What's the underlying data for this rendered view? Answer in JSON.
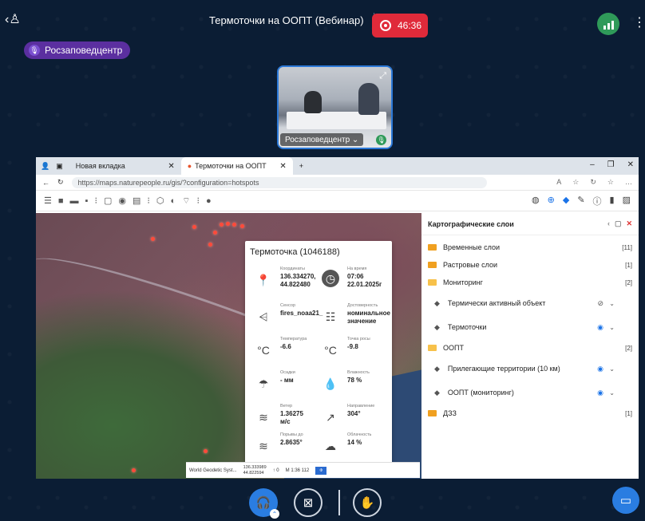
{
  "topbar": {
    "back_icon": "‹♙",
    "title": "Термоточки на ООПТ (Вебинар)",
    "recording_time": "46:36",
    "more_icon": "⋮"
  },
  "organizer_chip": "Росзаповедцентр",
  "video_tile": {
    "name": "Росзаповедцентр ⌄"
  },
  "browser": {
    "tab_new": "Новая вкладка",
    "tab_active": "Термоточки на ООПТ",
    "url": "https://maps.naturepeople.ru/gis/?configuration=hotspots"
  },
  "popup": {
    "title": "Термоточка (1046188)",
    "coords_label": "Координаты",
    "coords_value": "136.334270,\n44.822480",
    "time_label": "На время",
    "time_value": "07:06\n22.01.2025г",
    "sensor_label": "Сенсор",
    "sensor_value": "fires_noaa21_",
    "reliability_label": "Достоверность",
    "reliability_value": "номинальное\nзначение",
    "temp_label": "Температура",
    "temp_value": "-6.6",
    "dew_label": "Точка росы",
    "dew_value": "-9.8",
    "precip_label": "Осадки",
    "precip_value": "- мм",
    "humidity_label": "Влажность",
    "humidity_value": "78 %",
    "wind_label": "Ветер",
    "wind_value": "1.36275\nм/с",
    "direction_label": "Направление",
    "direction_value": "304°",
    "gust_label": "Порывы до",
    "gust_value": "2.8635°",
    "cloud_label": "Облачность",
    "cloud_value": "14 %"
  },
  "statusbar": {
    "crs": "World Geodetic Syst...",
    "coords": "136.333989\n44.822594",
    "rotation": "↑ 0",
    "scale": "М 1:36 112",
    "go": "Ф"
  },
  "layers": {
    "title": "Картографические слои",
    "items": [
      {
        "label": "Временные слои",
        "count": "[11]"
      },
      {
        "label": "Растровые слои",
        "count": "[1]"
      },
      {
        "label": "Мониторинг",
        "count": "[2]"
      },
      {
        "label": "Термически активный объект"
      },
      {
        "label": "Термоточки"
      },
      {
        "label": "ООПТ",
        "count": "[2]"
      },
      {
        "label": "Прилегающие территории (10 км)"
      },
      {
        "label": "ООПТ (мониторинг)"
      },
      {
        "label": "ДЗЗ",
        "count": "[1]"
      }
    ]
  },
  "colors": {
    "background": "#0b1d34",
    "record": "#e02a3a",
    "accent": "#2a7de1",
    "chip": "#5b2fa0"
  }
}
